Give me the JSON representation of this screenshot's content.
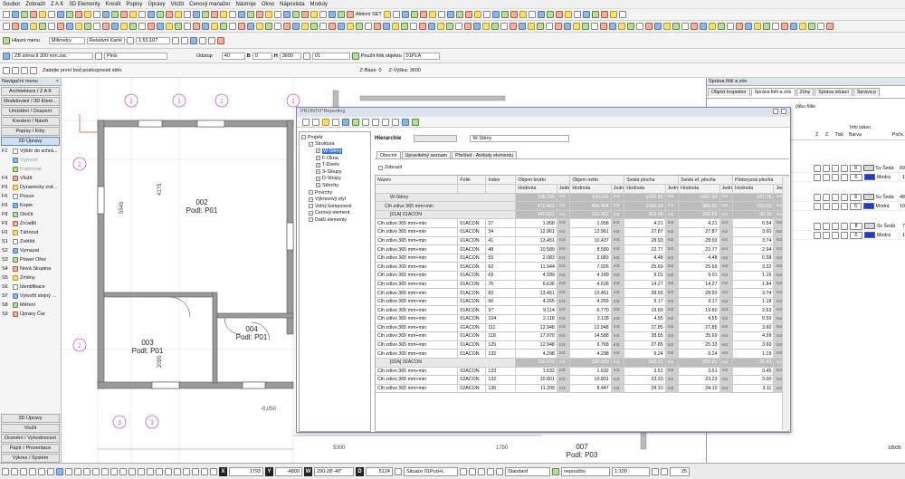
{
  "menu": [
    "Soubor",
    "Zobrazit",
    "Z A K",
    "3D Elementy",
    "Kreslit",
    "Popisy",
    "Úpravy",
    "Vložit",
    "Cenový manažer",
    "Nástroje",
    "Okno",
    "Nápověda",
    "Moduly"
  ],
  "toolbar1": {
    "set_label": "Aktivní SET"
  },
  "toolbar3": {
    "main_menu": "Hlavní menu",
    "units": "Milimetry",
    "coord": "Relativní Karté",
    "scale": "1:53.107"
  },
  "toolbar4": {
    "wall_type": "ŽB stěna tl 300 mm.zac",
    "fill": "Plná",
    "offset_label": "Odstup",
    "offset_value": "40",
    "b_label": "B",
    "b_value": "0",
    "h_label": "H",
    "h_value": "3600",
    "layer": "01",
    "layer_check": "Použít fólk objektu",
    "layer_name": "01PLA"
  },
  "prompt": {
    "text": "Zadejte první bod posloupnosti stěn.",
    "zbase": "Z-Báze: 0",
    "zheight": "Z-Výška: 3600"
  },
  "nav": {
    "title": "Navigační menu",
    "x_label": "×",
    "buttons": [
      "Architektura / Z A K",
      "Modelování / 3D Elem...",
      "Umístění / Osazení",
      "Kreslení / Návrh",
      "Popisy / Kóty",
      "2D Úpravy"
    ],
    "commands": [
      {
        "key": "F1",
        "label": "Výběr do schrá...",
        "disabled": false
      },
      {
        "key": "",
        "label": "Vyjmout",
        "disabled": true
      },
      {
        "key": "",
        "label": "Kopírovat",
        "disabled": true
      },
      {
        "key": "F4",
        "label": "Vložit",
        "disabled": false
      },
      {
        "key": "F5",
        "label": "Dynamicky zvě...",
        "disabled": false
      },
      {
        "key": "F6",
        "label": "Posun",
        "disabled": false
      },
      {
        "key": "F6",
        "label": "Kopie",
        "disabled": false
      },
      {
        "key": "F8",
        "label": "Otočit",
        "disabled": false
      },
      {
        "key": "F9",
        "label": "Zrcadlit",
        "disabled": false
      },
      {
        "key": "F0",
        "label": "Táhnout",
        "disabled": false
      },
      {
        "key": "S1",
        "label": "Zvětšit",
        "disabled": false
      },
      {
        "key": "S2",
        "label": "Vymazat",
        "disabled": false
      },
      {
        "key": "S3",
        "label": "Power Ořez",
        "disabled": false
      },
      {
        "key": "S4",
        "label": "Nová Skupina",
        "disabled": false
      },
      {
        "key": "S5",
        "label": "Změny",
        "disabled": false
      },
      {
        "key": "S6",
        "label": "Identifikace",
        "disabled": false
      },
      {
        "key": "S7",
        "label": "Vytvořit stejný ...",
        "disabled": false
      },
      {
        "key": "S8",
        "label": "Měření",
        "disabled": false
      },
      {
        "key": "S9",
        "label": "Úpravy Čar",
        "disabled": false
      }
    ],
    "bottom_buttons": [
      "3D Úpravy",
      "Vložit",
      "Ocenění / Vyhodnocení",
      "Papír / Prezentace",
      "Výkres / Systém"
    ]
  },
  "drawing": {
    "rooms": [
      {
        "id": "002",
        "sub": "Podl: P01"
      },
      {
        "id": "003",
        "sub": "Podl: P01"
      },
      {
        "id": "004",
        "sub": "Podl: P01"
      },
      {
        "id": "007",
        "sub": "Podl: P03"
      }
    ],
    "grid_bubbles": [
      "1",
      "1",
      "1",
      "1",
      "2",
      "2",
      "3",
      "3"
    ],
    "dims": [
      "5545",
      "4175",
      "2095",
      "-0,050",
      "5300",
      "1750"
    ]
  },
  "right": {
    "title": "Správa fólií a zón",
    "tabs": [
      "Objekt Inspektor",
      "Správa fólií a zón",
      "Zóny",
      "Správa situací",
      "Správa p"
    ],
    "headers": {
      "h1": "Info stavu",
      "z1": "Z.",
      "z2": "Z.",
      "tisk": "Tisk",
      "barva": "Barva",
      "poc": "Poče..."
    },
    "rows": [
      {
        "num": "8",
        "name": "Sv Šedá",
        "val": "69"
      },
      {
        "num": "6",
        "name": "Modrá",
        "val": "1"
      },
      {
        "num": "8",
        "name": "Sv Šedá",
        "val": "48"
      },
      {
        "num": "6",
        "name": "Modrá",
        "val": "10"
      },
      {
        "num": "8",
        "name": "Sv Šedá",
        "val": "7"
      },
      {
        "num": "6",
        "name": "Modrá",
        "val": "1"
      }
    ],
    "partial_header": "ýšku fólie",
    "bottom_num": "18936"
  },
  "colors": {
    "accent": "#2e5cb8",
    "modra": "#1e3ad8",
    "grid_bubble": "#c060c0",
    "wall_hatch": "#666666",
    "ok": "#2a9a2a"
  },
  "dialog": {
    "title": "PRONTO*Reporting",
    "tree": [
      {
        "label": "Projekt",
        "level": 0,
        "sel": false
      },
      {
        "label": "Struktura",
        "level": 1,
        "sel": false
      },
      {
        "label": "W-Stěny",
        "level": 2,
        "sel": true
      },
      {
        "label": "F-Okna",
        "level": 2,
        "sel": false
      },
      {
        "label": "T-Dveře",
        "level": 2,
        "sel": false
      },
      {
        "label": "S-Sloupy",
        "level": 2,
        "sel": false
      },
      {
        "label": "D-Stropy",
        "level": 2,
        "sel": false
      },
      {
        "label": "Střechy",
        "level": 2,
        "sel": false
      },
      {
        "label": "Povrchy",
        "level": 1,
        "sel": false
      },
      {
        "label": "Výkresový styl",
        "level": 1,
        "sel": false
      },
      {
        "label": "Volný komponent",
        "level": 1,
        "sel": false
      },
      {
        "label": "Cenový element",
        "level": 1,
        "sel": false
      },
      {
        "label": "Další elementy",
        "level": 1,
        "sel": false
      }
    ],
    "hierarchy_label": "Hierarchie",
    "hierarchy_value": "W-Stěny",
    "tabs": [
      "Obecné",
      "Upravitelný seznam",
      "Přehled - Atributy elementu"
    ],
    "show_label": "Zobrazit",
    "headers": [
      "Název",
      "Fólie",
      "Index",
      "Objem brutto",
      "Objem netto",
      "Svislá plocha",
      "Svislá ef. plocha",
      "Půdorysná plocha"
    ],
    "subheaders": [
      "Hodnota",
      "Jedn",
      "Hodnota",
      "Jedn",
      "Hodnota",
      "Jedn",
      "Hodnota",
      "Jedn",
      "Hodnota",
      "Jedno"
    ],
    "groups": [
      {
        "label": "W-Stěny",
        "vals": [
          "168.293",
          "m3",
          "105.116",
          "m3",
          "1290.80",
          "m2",
          "1657.02",
          "m2",
          "247.78",
          "m2"
        ],
        "level": 0
      },
      {
        "label": "Cih zdivo 365 mm+min",
        "vals": [
          "472.463",
          "m3",
          "409.404",
          "m3",
          "1060.14",
          "m2",
          "989.62",
          "m2",
          "151.03",
          "m2"
        ],
        "level": 1
      },
      {
        "label": "[01A] 01ACON",
        "vals": [
          "140.622",
          "m3",
          "110.962",
          "m3",
          "303.06",
          "m2",
          "292.55",
          "m2",
          "39.18",
          "m2"
        ],
        "level": 2
      }
    ],
    "rows": [
      {
        "name": "Cih zdivo 365 mm+min",
        "folie": "01ACON",
        "idx": "27",
        "vb": "1.958",
        "vn": "1.958",
        "sp": "4.21",
        "sep": "4.21",
        "pp": "0.54"
      },
      {
        "name": "Cih zdivo 365 mm+min",
        "folie": "01ACON",
        "idx": "34",
        "vb": "12.961",
        "vn": "12.961",
        "sp": "27.87",
        "sep": "27.87",
        "pp": "3.60"
      },
      {
        "name": "Cih zdivo 365 mm+min",
        "folie": "01ACON",
        "idx": "41",
        "vb": "13.451",
        "vn": "10.437",
        "sp": "28.93",
        "sep": "28.93",
        "pp": "3.74"
      },
      {
        "name": "Cih zdivo 365 mm+min",
        "folie": "01ACON",
        "idx": "48",
        "vb": "10.589",
        "vn": "8.580",
        "sp": "22.77",
        "sep": "22.77",
        "pp": "2.94"
      },
      {
        "name": "Cih zdivo 365 mm+min",
        "folie": "01ACON",
        "idx": "55",
        "vb": "2.083",
        "vn": "2.083",
        "sp": "4.48",
        "sep": "4.48",
        "pp": "0.58"
      },
      {
        "name": "Cih zdivo 365 mm+min",
        "folie": "01ACON",
        "idx": "62",
        "vb": "11.944",
        "vn": "7.926",
        "sp": "25.69",
        "sep": "25.69",
        "pp": "3.32"
      },
      {
        "name": "Cih zdivo 365 mm+min",
        "folie": "01ACON",
        "idx": "69",
        "vb": "4.189",
        "vn": "4.189",
        "sp": "9.01",
        "sep": "9.01",
        "pp": "1.16"
      },
      {
        "name": "Cih zdivo 365 mm+min",
        "folie": "01ACON",
        "idx": "76",
        "vb": "6.636",
        "vn": "4.628",
        "sp": "14.27",
        "sep": "14.27",
        "pp": "1.84"
      },
      {
        "name": "Cih zdivo 365 mm+min",
        "folie": "01ACON",
        "idx": "83",
        "vb": "13.451",
        "vn": "13.451",
        "sp": "28.93",
        "sep": "28.93",
        "pp": "3.74"
      },
      {
        "name": "Cih zdivo 365 mm+min",
        "folie": "01ACON",
        "idx": "90",
        "vb": "4.265",
        "vn": "4.265",
        "sp": "9.17",
        "sep": "9.17",
        "pp": "1.18"
      },
      {
        "name": "Cih zdivo 365 mm+min",
        "folie": "01ACON",
        "idx": "97",
        "vb": "9.114",
        "vn": "6.770",
        "sp": "19.60",
        "sep": "19.60",
        "pp": "2.53"
      },
      {
        "name": "Cih zdivo 365 mm+min",
        "folie": "01ACON",
        "idx": "104",
        "vb": "2.118",
        "vn": "2.118",
        "sp": "4.55",
        "sep": "4.55",
        "pp": "0.59"
      },
      {
        "name": "Cih zdivo 365 mm+min",
        "folie": "01ACON",
        "idx": "111",
        "vb": "12.948",
        "vn": "12.948",
        "sp": "27.85",
        "sep": "27.85",
        "pp": "3.60"
      },
      {
        "name": "Cih zdivo 365 mm+min",
        "folie": "01ACON",
        "idx": "118",
        "vb": "17.970",
        "vn": "14.588",
        "sp": "38.65",
        "sep": "35.69",
        "pp": "4.99"
      },
      {
        "name": "Cih zdivo 365 mm+min",
        "folie": "01ACON",
        "idx": "125",
        "vb": "12.948",
        "vn": "9.768",
        "sp": "27.85",
        "sep": "25.33",
        "pp": "3.60"
      },
      {
        "name": "Cih zdivo 365 mm+min",
        "folie": "01ACON",
        "idx": "132",
        "vb": "4.298",
        "vn": "4.298",
        "sp": "9.24",
        "sep": "9.24",
        "pp": "1.19"
      }
    ],
    "group2": {
      "label": "[02A] 02ACON",
      "vals": [
        "116.672",
        "m3",
        "100.260",
        "m3",
        "250.91",
        "m2",
        "250.91",
        "m2",
        "32.43",
        "m2"
      ]
    },
    "rows2": [
      {
        "name": "Cih zdivo 365 mm+min",
        "folie": "02ACON",
        "idx": "133",
        "vb": "1.632",
        "vn": "1.632",
        "sp": "3.51",
        "sep": "3.51",
        "pp": "0.45"
      },
      {
        "name": "Cih zdivo 365 mm+min",
        "folie": "02ACON",
        "idx": "132",
        "vb": "10.801",
        "vn": "10.801",
        "sp": "23.23",
        "sep": "23.23",
        "pp": "3.00"
      },
      {
        "name": "Cih zdivo 365 mm+min",
        "folie": "02ACON",
        "idx": "136",
        "vb": "11.209",
        "vn": "8.447",
        "sp": "24.10",
        "sep": "24.10",
        "pp": "3.11"
      }
    ],
    "units_m3": "m3",
    "units_m2": "m2"
  },
  "status": {
    "x_key": "X",
    "x_val": "1793",
    "y_key": "Y",
    "y_val": "-4800",
    "w_key": "W",
    "w_val": "290-28'-40\"",
    "d_key": "D",
    "d_val": "5124",
    "situace": "Situace  01Pud+L",
    "standard": "Standard",
    "nepouzito": "nepoužito",
    "scale": "1:100",
    "zoom": "25"
  }
}
